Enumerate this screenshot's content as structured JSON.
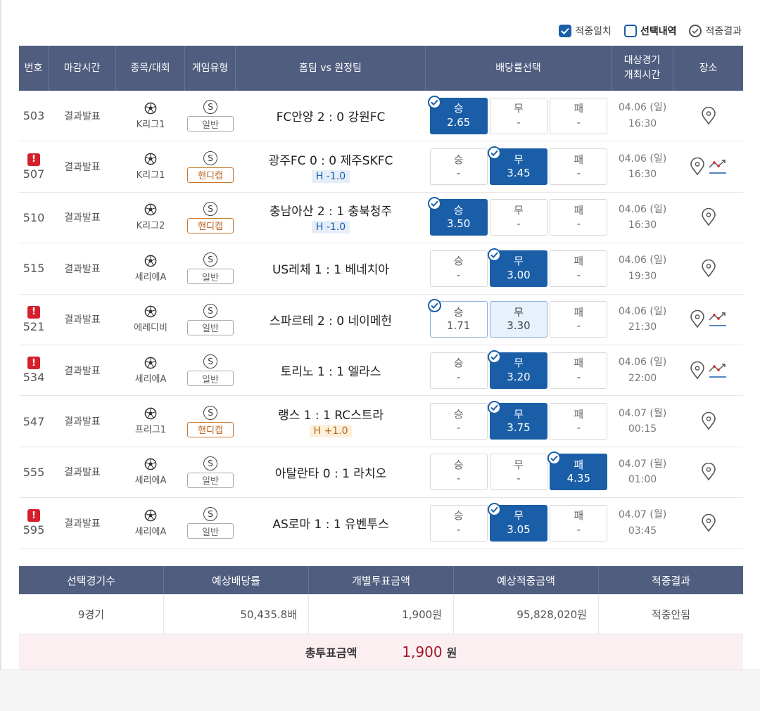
{
  "legend": [
    {
      "label": "적중일치",
      "style": "filled"
    },
    {
      "label": "선택내역",
      "style": "empty"
    },
    {
      "label": "적중결과",
      "style": "circle"
    }
  ],
  "headers": [
    "번호",
    "마감시간",
    "종목/대회",
    "게임유형",
    "홈팀 vs 원정팀",
    "배당률선택",
    "대상경기\n개최시간",
    "장소"
  ],
  "header_time_line1": "대상경기",
  "header_time_line2": "개최시간",
  "matches": [
    {
      "no": "503",
      "warn": false,
      "deadline": "결과발표",
      "league": "K리그1",
      "type_symbol": "S",
      "type": "일반",
      "handicap_type": false,
      "match": "FC안양 2 : 0 강원FC",
      "handicap": "",
      "win": {
        "label": "승",
        "value": "2.65",
        "state": "selected"
      },
      "draw": {
        "label": "무",
        "value": "-",
        "state": "none"
      },
      "lose": {
        "label": "패",
        "value": "-",
        "state": "none"
      },
      "date": "04.06 (일)",
      "time": "16:30",
      "chart": false
    },
    {
      "no": "507",
      "warn": true,
      "deadline": "결과발표",
      "league": "K리그1",
      "type_symbol": "S",
      "type": "핸디캡",
      "handicap_type": true,
      "match": "광주FC 0 : 0 제주SKFC",
      "handicap": "H -1.0",
      "handicap_sign": "minus",
      "win": {
        "label": "승",
        "value": "-",
        "state": "none"
      },
      "draw": {
        "label": "무",
        "value": "3.45",
        "state": "selected"
      },
      "lose": {
        "label": "패",
        "value": "-",
        "state": "none"
      },
      "date": "04.06 (일)",
      "time": "16:30",
      "chart": true
    },
    {
      "no": "510",
      "warn": false,
      "deadline": "결과발표",
      "league": "K리그2",
      "type_symbol": "S",
      "type": "핸디캡",
      "handicap_type": true,
      "match": "충남아산 2 : 1 충북청주",
      "handicap": "H -1.0",
      "handicap_sign": "minus",
      "win": {
        "label": "승",
        "value": "3.50",
        "state": "selected"
      },
      "draw": {
        "label": "무",
        "value": "-",
        "state": "none"
      },
      "lose": {
        "label": "패",
        "value": "-",
        "state": "none"
      },
      "date": "04.06 (일)",
      "time": "16:30",
      "chart": false
    },
    {
      "no": "515",
      "warn": false,
      "deadline": "결과발표",
      "league": "세리에A",
      "type_symbol": "S",
      "type": "일반",
      "handicap_type": false,
      "match": "US레체 1 : 1 베네치아",
      "handicap": "",
      "win": {
        "label": "승",
        "value": "-",
        "state": "none"
      },
      "draw": {
        "label": "무",
        "value": "3.00",
        "state": "selected"
      },
      "lose": {
        "label": "패",
        "value": "-",
        "state": "none"
      },
      "date": "04.06 (일)",
      "time": "19:30",
      "chart": false
    },
    {
      "no": "521",
      "warn": true,
      "deadline": "결과발표",
      "league": "에레디비",
      "type_symbol": "S",
      "type": "일반",
      "handicap_type": false,
      "match": "스파르테 2 : 0 네이메헌",
      "handicap": "",
      "win": {
        "label": "승",
        "value": "1.71",
        "state": "outline"
      },
      "draw": {
        "label": "무",
        "value": "3.30",
        "state": "light"
      },
      "lose": {
        "label": "패",
        "value": "-",
        "state": "none"
      },
      "date": "04.06 (일)",
      "time": "21:30",
      "chart": true
    },
    {
      "no": "534",
      "warn": true,
      "deadline": "결과발표",
      "league": "세리에A",
      "type_symbol": "S",
      "type": "일반",
      "handicap_type": false,
      "match": "토리노 1 : 1 엘라스",
      "handicap": "",
      "win": {
        "label": "승",
        "value": "-",
        "state": "none"
      },
      "draw": {
        "label": "무",
        "value": "3.20",
        "state": "selected"
      },
      "lose": {
        "label": "패",
        "value": "-",
        "state": "none"
      },
      "date": "04.06 (일)",
      "time": "22:00",
      "chart": true
    },
    {
      "no": "547",
      "warn": false,
      "deadline": "결과발표",
      "league": "프리그1",
      "type_symbol": "S",
      "type": "핸디캡",
      "handicap_type": true,
      "match": "랭스 1 : 1 RC스트라",
      "handicap": "H +1.0",
      "handicap_sign": "plus",
      "win": {
        "label": "승",
        "value": "-",
        "state": "none"
      },
      "draw": {
        "label": "무",
        "value": "3.75",
        "state": "selected"
      },
      "lose": {
        "label": "패",
        "value": "-",
        "state": "none"
      },
      "date": "04.07 (월)",
      "time": "00:15",
      "chart": false
    },
    {
      "no": "555",
      "warn": false,
      "deadline": "결과발표",
      "league": "세리에A",
      "type_symbol": "S",
      "type": "일반",
      "handicap_type": false,
      "match": "아탈란타 0 : 1 라치오",
      "handicap": "",
      "win": {
        "label": "승",
        "value": "-",
        "state": "none"
      },
      "draw": {
        "label": "무",
        "value": "-",
        "state": "none"
      },
      "lose": {
        "label": "패",
        "value": "4.35",
        "state": "selected"
      },
      "date": "04.07 (월)",
      "time": "01:00",
      "chart": false
    },
    {
      "no": "595",
      "warn": true,
      "deadline": "결과발표",
      "league": "세리에A",
      "type_symbol": "S",
      "type": "일반",
      "handicap_type": false,
      "match": "AS로마 1 : 1 유벤투스",
      "handicap": "",
      "win": {
        "label": "승",
        "value": "-",
        "state": "none"
      },
      "draw": {
        "label": "무",
        "value": "3.05",
        "state": "selected"
      },
      "lose": {
        "label": "패",
        "value": "-",
        "state": "none"
      },
      "date": "04.07 (월)",
      "time": "03:45",
      "chart": false
    }
  ],
  "summary": {
    "headers": [
      "선택경기수",
      "예상배당률",
      "개별투표금액",
      "예상적중금액",
      "적중결과"
    ],
    "values": [
      "9경기",
      "50,435.8배",
      "1,900원",
      "95,828,020원",
      "적중안됨"
    ]
  },
  "total": {
    "label": "총투표금액",
    "amount": "1,900",
    "unit": "원"
  },
  "colors": {
    "header": "#4f5d7f",
    "selected": "#1a5ea8",
    "warn": "#d4202c",
    "total_amount": "#a3162a",
    "total_bg": "#fbeff1"
  }
}
